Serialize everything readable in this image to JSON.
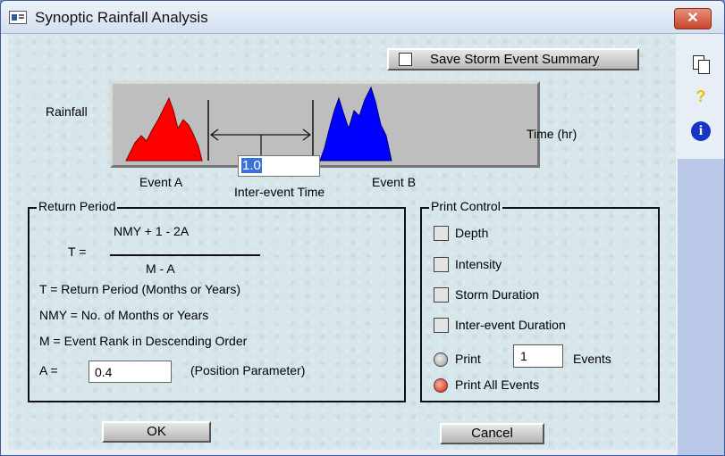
{
  "window": {
    "title": "Synoptic Rainfall Analysis",
    "close_glyph": "✕"
  },
  "sidebar": {
    "copy_icon": "copy-icon",
    "help_glyph": "?",
    "help_icon": "help-icon",
    "info_glyph": "i",
    "info_icon": "info-icon"
  },
  "save_summary": {
    "label": "Save Storm Event Summary",
    "checked": false
  },
  "diagram": {
    "rainfall_label": "Rainfall",
    "time_label": "Time (hr)",
    "event_a_label": "Event A",
    "event_b_label": "Event B",
    "interevent_label": "Inter-event Time",
    "interevent_value": "1.0",
    "event_a_color": "#ff0000",
    "event_b_color": "#0000ff"
  },
  "return_period": {
    "title": "Return Period",
    "t_eq": "T =",
    "numerator": "NMY + 1 - 2A",
    "denominator": "M - A",
    "def_t": "T = Return Period (Months or Years)",
    "def_nmy": "NMY = No. of Months or Years",
    "def_m": "M = Event Rank in Descending Order",
    "a_label": "A =",
    "a_value": "0.4",
    "a_note": "(Position Parameter)"
  },
  "print_control": {
    "title": "Print Control",
    "checkboxes": [
      {
        "label": "Depth",
        "checked": false
      },
      {
        "label": "Intensity",
        "checked": false
      },
      {
        "label": "Storm Duration",
        "checked": false
      },
      {
        "label": "Inter-event Duration",
        "checked": false
      }
    ],
    "print_label": "Print",
    "events_value": "1",
    "events_label": "Events",
    "print_all_label": "Print All Events",
    "selected_option": "Print All Events"
  },
  "buttons": {
    "ok": "OK",
    "cancel": "Cancel"
  }
}
